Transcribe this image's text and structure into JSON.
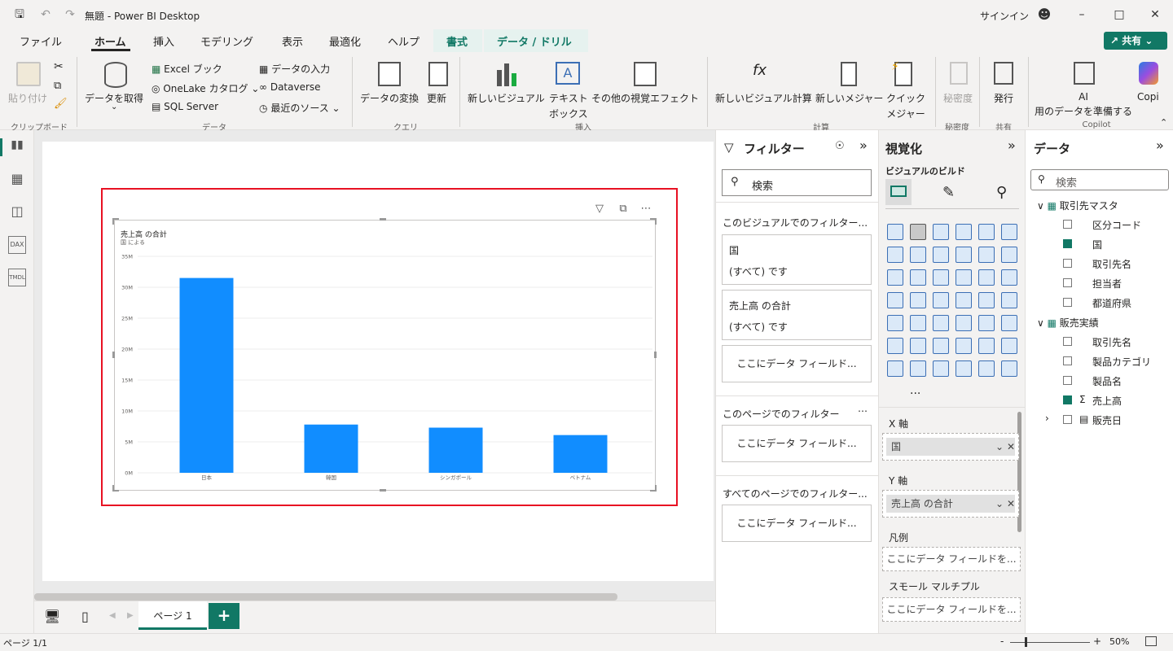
{
  "window": {
    "title": "無題 - Power BI Desktop",
    "signin": "サインイン"
  },
  "menu": {
    "items": [
      "ファイル",
      "ホーム",
      "挿入",
      "モデリング",
      "表示",
      "最適化",
      "ヘルプ",
      "書式",
      "データ / ドリル"
    ],
    "share": "共有"
  },
  "ribbon": {
    "paste": "貼り付け",
    "get_data": "データを取得",
    "excel": "Excel ブック",
    "onelake": "OneLake カタログ",
    "sql": "SQL Server",
    "enter_data": "データの入力",
    "dataverse": "Dataverse",
    "recent": "最近のソース",
    "transform": "データの変換",
    "refresh": "更新",
    "new_visual": "新しいビジュアル",
    "textbox1": "テキスト",
    "textbox2": "ボックス",
    "more_visuals": "その他の視覚エフェクト",
    "new_calc": "新しいビジュアル計算",
    "new_measure": "新しいメジャー",
    "quick1": "クイック",
    "quick2": "メジャー",
    "sensitivity": "秘密度",
    "publish": "発行",
    "ai1": "AI",
    "ai2": "用のデータを準備する",
    "copilot": "Copi",
    "groups": {
      "clipboard": "クリップボード",
      "data": "データ",
      "query": "クエリ",
      "insert": "挿入",
      "calc": "計算",
      "sens": "秘密度",
      "share": "共有",
      "copilot": "Copilot"
    }
  },
  "filters": {
    "title": "フィルター",
    "search": "検索",
    "visual_section": "このビジュアルでのフィルター...",
    "cards": [
      {
        "name": "国",
        "value": "(すべて) です"
      },
      {
        "name": "売上高 の合計",
        "value": "(すべて) です"
      }
    ],
    "drop": "ここにデータ フィールド...",
    "page_section": "このページでのフィルター",
    "all_section": "すべてのページでのフィルター..."
  },
  "viz": {
    "title": "視覚化",
    "build": "ビジュアルのビルド",
    "more": "...",
    "x_axis": "X 軸",
    "x_field": "国",
    "y_axis": "Y 軸",
    "y_field": "売上高 の合計",
    "legend": "凡例",
    "drop": "ここにデータ フィールドを...",
    "small_multiples": "スモール マルチプル"
  },
  "data_pane": {
    "title": "データ",
    "search": "検索",
    "tables": [
      {
        "name": "取引先マスタ",
        "fields": [
          {
            "name": "区分コード",
            "checked": false
          },
          {
            "name": "国",
            "checked": true
          },
          {
            "name": "取引先名",
            "checked": false
          },
          {
            "name": "担当者",
            "checked": false
          },
          {
            "name": "都道府県",
            "checked": false
          }
        ]
      },
      {
        "name": "販売実績",
        "fields": [
          {
            "name": "取引先名",
            "checked": false
          },
          {
            "name": "製品カテゴリ",
            "checked": false
          },
          {
            "name": "製品名",
            "checked": false
          },
          {
            "name": "売上高",
            "checked": true,
            "sigma": true
          },
          {
            "name": "販売日",
            "checked": false,
            "date": true
          }
        ]
      }
    ]
  },
  "tabs": {
    "page": "ページ 1",
    "add": "+"
  },
  "status": {
    "page": "ページ 1/1",
    "zoom": "50%"
  },
  "chart_data": {
    "type": "bar",
    "title": "売上高 の合計",
    "subtitle": "国 による",
    "categories": [
      "日本",
      "韓国",
      "シンガポール",
      "ベトナム"
    ],
    "values": [
      31.5,
      7.8,
      7.3,
      6.1
    ],
    "unit": "M",
    "ylim": [
      0,
      35
    ],
    "yticks": [
      "0M",
      "5M",
      "10M",
      "15M",
      "20M",
      "25M",
      "30M",
      "35M"
    ],
    "color": "#118dff",
    "grid": true
  }
}
